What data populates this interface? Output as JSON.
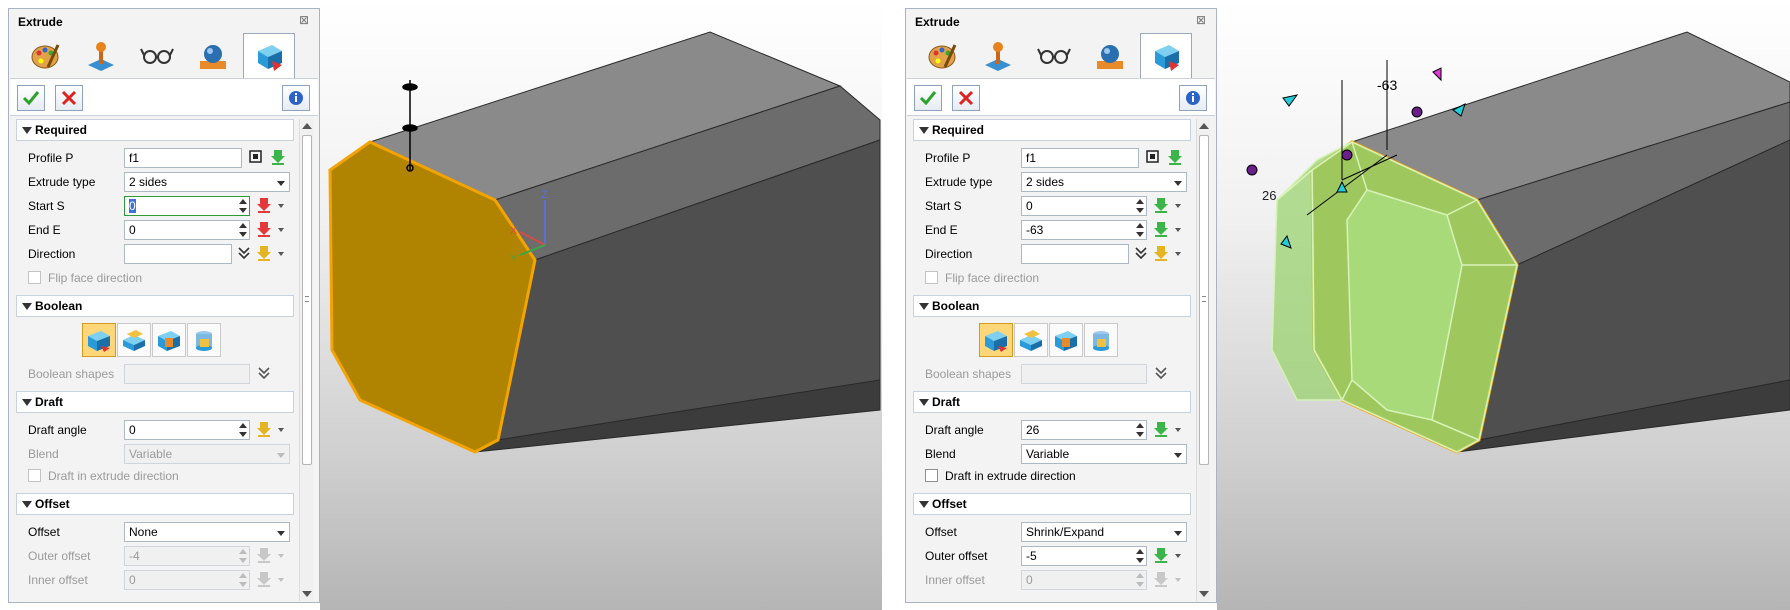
{
  "left": {
    "panel_title": "Extrude",
    "required": {
      "title": "Required",
      "profile_label": "Profile P",
      "profile_value": "f1",
      "extrude_type_label": "Extrude type",
      "extrude_type_value": "2 sides",
      "start_label": "Start S",
      "start_value": "0",
      "end_label": "End E",
      "end_value": "0",
      "direction_label": "Direction",
      "direction_value": "",
      "flip_label": "Flip face direction"
    },
    "boolean": {
      "title": "Boolean",
      "shapes_label": "Boolean shapes",
      "shapes_value": ""
    },
    "draft": {
      "title": "Draft",
      "angle_label": "Draft angle",
      "angle_value": "0",
      "blend_label": "Blend",
      "blend_value": "Variable",
      "extrude_dir_label": "Draft in extrude direction"
    },
    "offset": {
      "title": "Offset",
      "offset_label": "Offset",
      "offset_value": "None",
      "outer_label": "Outer offset",
      "outer_value": "-4",
      "inner_label": "Inner offset",
      "inner_value": "0"
    },
    "viewport": {
      "axis_z": "Z",
      "axis_x": "X",
      "axis_y": "Y",
      "face_color": "#b08400"
    }
  },
  "right": {
    "panel_title": "Extrude",
    "required": {
      "title": "Required",
      "profile_label": "Profile P",
      "profile_value": "f1",
      "extrude_type_label": "Extrude type",
      "extrude_type_value": "2 sides",
      "start_label": "Start S",
      "start_value": "0",
      "end_label": "End E",
      "end_value": "-63",
      "direction_label": "Direction",
      "direction_value": "",
      "flip_label": "Flip face direction"
    },
    "boolean": {
      "title": "Boolean",
      "shapes_label": "Boolean shapes",
      "shapes_value": ""
    },
    "draft": {
      "title": "Draft",
      "angle_label": "Draft angle",
      "angle_value": "26",
      "blend_label": "Blend",
      "blend_value": "Variable",
      "extrude_dir_label": "Draft in extrude direction"
    },
    "offset": {
      "title": "Offset",
      "offset_label": "Offset",
      "offset_value": "Shrink/Expand",
      "outer_label": "Outer offset",
      "outer_value": "-5",
      "inner_label": "Inner offset",
      "inner_value": "0"
    },
    "viewport": {
      "dim_end": "-63",
      "dim_draft": "26",
      "preview_color": "#9bd36f"
    }
  }
}
